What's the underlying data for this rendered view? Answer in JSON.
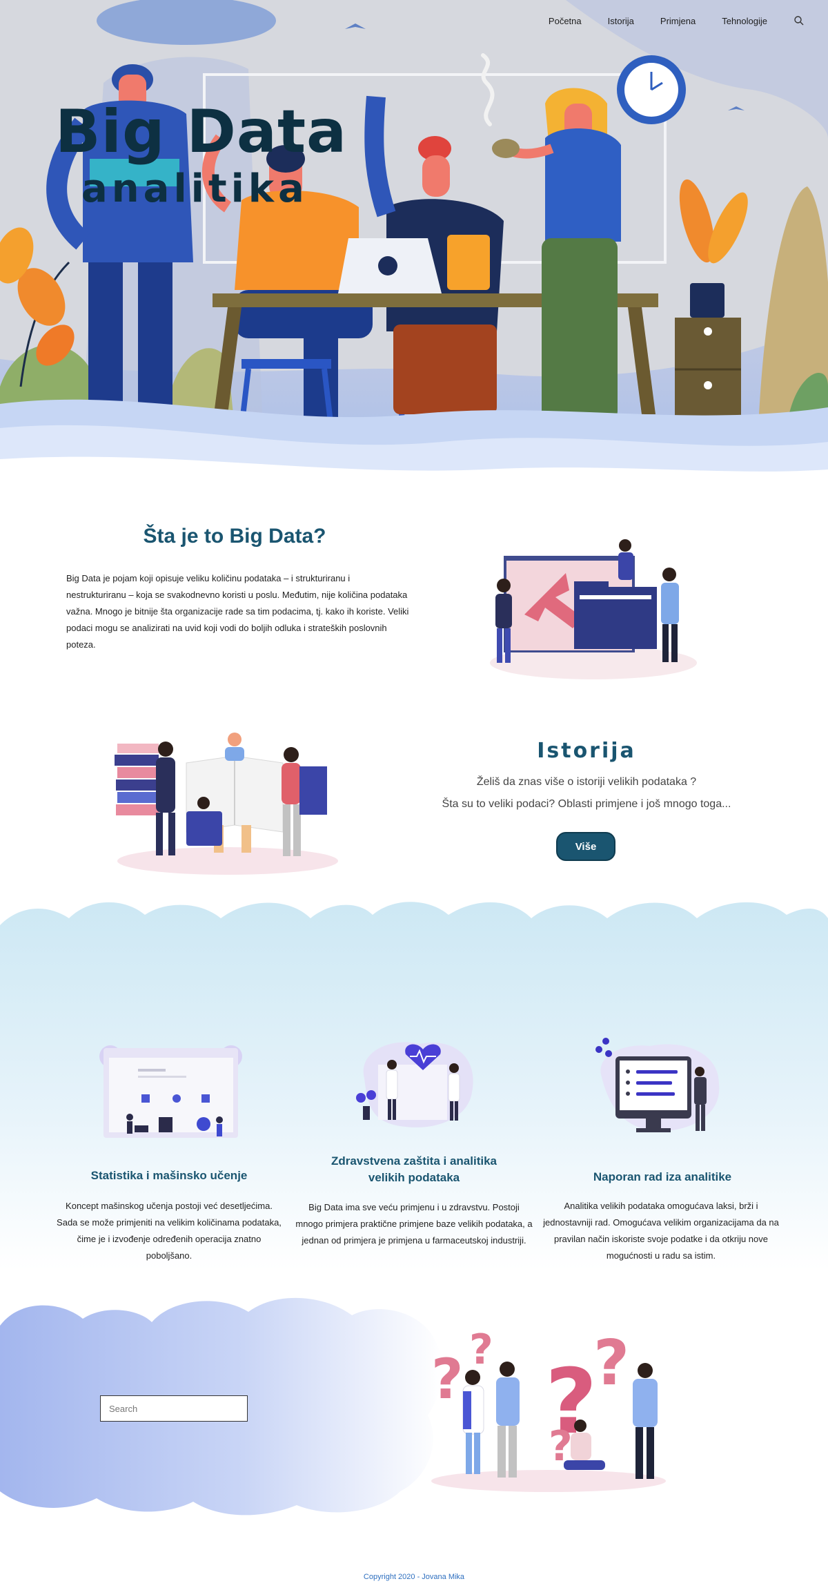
{
  "nav": {
    "items": [
      "Početna",
      "Istorija",
      "Primjena",
      "Tehnologije"
    ],
    "search_icon": "search-icon"
  },
  "hero": {
    "title": "Big Data",
    "subtitle": "analitika"
  },
  "about": {
    "title": "Šta je to Big Data?",
    "text": " Big Data je pojam koji opisuje veliku količinu podataka – i strukturiranu i nestrukturiranu – koja se svakodnevno koristi u poslu. Međutim, nije količina podataka važna. Mnogo je  bitnije šta organizacije rade sa tim podacima, tj. kako ih koriste. Veliki podaci mogu se analizirati na uvid koji vodi do boljih odluka i strateških poslovnih poteza."
  },
  "history": {
    "title": "Istorija",
    "line1": "Želiš da znas više o istoriji velikih podataka ?",
    "line2": "Šta su to veliki podaci? Oblasti primjene i još mnogo  toga...",
    "button": "Više"
  },
  "features": [
    {
      "title": "Statistika i mašinsko učenje",
      "text": "Koncept mašinskog učenja postoji već desetljećima. Sada se može primjeniti na velikim količinama podataka, čime je i izvođenje određenih operacija znatno poboljšano."
    },
    {
      "title": "Zdravstvena zaštita i analitika velikih podataka",
      "text": "Big Data ima sve veću primjenu i u zdravstvu. Postoji mnogo primjera praktične primjene baze velikih podataka, a jednan od primjera je primjena u farmaceutskoj industriji."
    },
    {
      "title": "Naporan rad iza analitike",
      "text": "Analitika velikih podataka omogućava laksi, brži i jednostavniji rad. Omogućava velikim organizacijama da na pravilan način iskoriste svoje podatke i da otkriju nove mogućnosti u radu sa istim."
    }
  ],
  "search": {
    "placeholder": "Search"
  },
  "footer": {
    "copyright": "Copyright 2020 - Jovana Mika"
  },
  "colors": {
    "accent": "#1a5570",
    "hero_title": "#0d3042",
    "footer_link": "#2e6fbf"
  }
}
